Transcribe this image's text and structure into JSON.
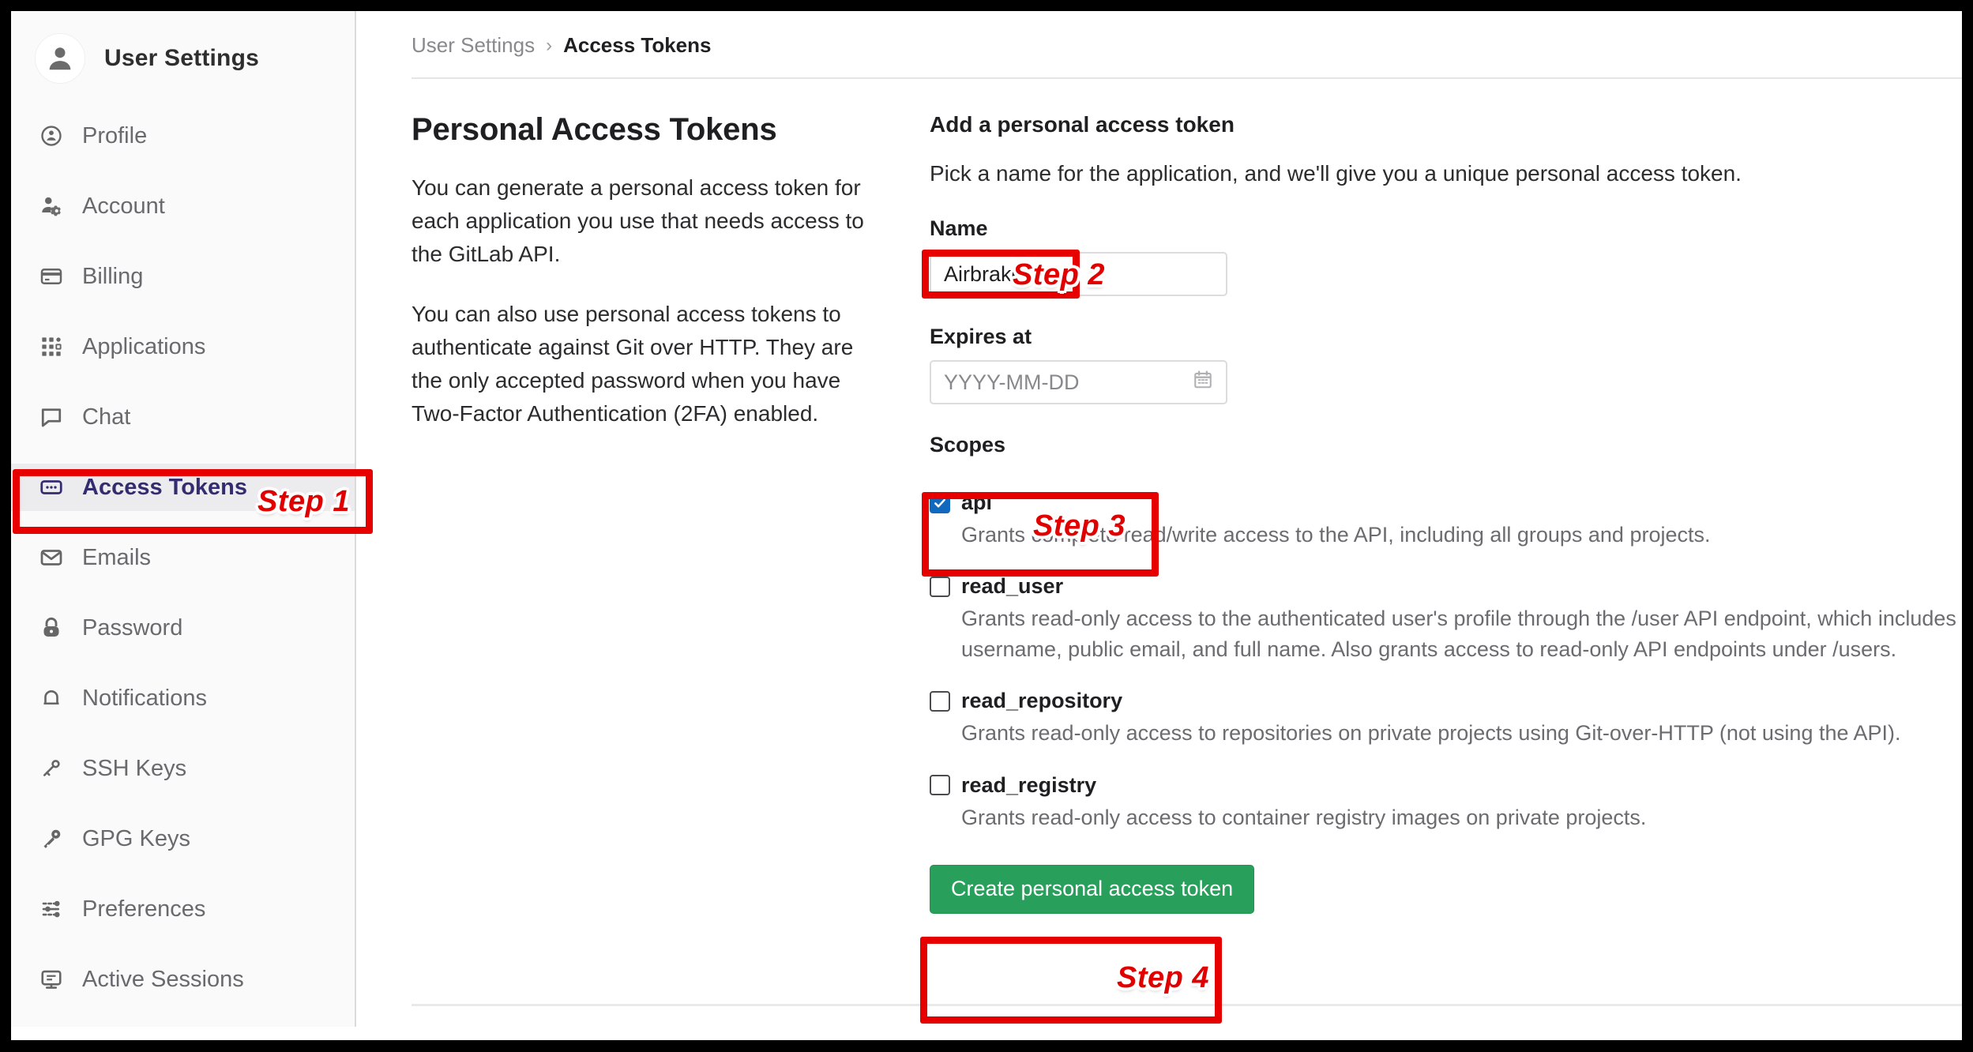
{
  "sidebar": {
    "title": "User Settings",
    "avatar_icon": "user-avatar-icon",
    "items": [
      {
        "label": "Profile",
        "icon": "profile-circle-icon",
        "active": false
      },
      {
        "label": "Account",
        "icon": "account-gear-icon",
        "active": false
      },
      {
        "label": "Billing",
        "icon": "credit-card-icon",
        "active": false
      },
      {
        "label": "Applications",
        "icon": "grid-apps-icon",
        "active": false
      },
      {
        "label": "Chat",
        "icon": "chat-bubble-icon",
        "active": false
      },
      {
        "label": "Access Tokens",
        "icon": "token-icon",
        "active": true
      },
      {
        "label": "Emails",
        "icon": "envelope-icon",
        "active": false
      },
      {
        "label": "Password",
        "icon": "lock-icon",
        "active": false
      },
      {
        "label": "Notifications",
        "icon": "bell-icon",
        "active": false
      },
      {
        "label": "SSH Keys",
        "icon": "key-small-icon",
        "active": false
      },
      {
        "label": "GPG Keys",
        "icon": "key-icon",
        "active": false
      },
      {
        "label": "Preferences",
        "icon": "sliders-icon",
        "active": false
      },
      {
        "label": "Active Sessions",
        "icon": "monitor-icon",
        "active": false
      }
    ]
  },
  "breadcrumb": {
    "parent": "User Settings",
    "separator": "›",
    "current": "Access Tokens"
  },
  "left_column": {
    "heading": "Personal Access Tokens",
    "paragraph_1": "You can generate a personal access token for each application you use that needs access to the GitLab API.",
    "paragraph_2": "You can also use personal access tokens to authenticate against Git over HTTP. They are the only accepted password when you have Two-Factor Authentication (2FA) enabled."
  },
  "form": {
    "title": "Add a personal access token",
    "subtitle": "Pick a name for the application, and we'll give you a unique personal access token.",
    "name_label": "Name",
    "name_value": "Airbrake",
    "expires_label": "Expires at",
    "expires_placeholder": "YYYY-MM-DD",
    "expires_value": "",
    "calendar_icon": "calendar-icon",
    "scopes_label": "Scopes",
    "scopes": [
      {
        "name": "api",
        "checked": true,
        "description": "Grants complete read/write access to the API, including all groups and projects."
      },
      {
        "name": "read_user",
        "checked": false,
        "description": "Grants read-only access to the authenticated user's profile through the /user API endpoint, which includes username, public email, and full name. Also grants access to read-only API endpoints under /users."
      },
      {
        "name": "read_repository",
        "checked": false,
        "description": "Grants read-only access to repositories on private projects using Git-over-HTTP (not using the API)."
      },
      {
        "name": "read_registry",
        "checked": false,
        "description": "Grants read-only access to container registry images on private projects."
      }
    ],
    "submit_label": "Create personal access token"
  },
  "annotations": {
    "step1": "Step 1",
    "step2": "Step 2",
    "step3": "Step 3",
    "step4": "Step 4",
    "highlight_color": "#e60000",
    "label_color": "#e00000"
  },
  "colors": {
    "accent_green": "#28a05c",
    "accent_blue": "#1068bf",
    "active_nav": "#332d70"
  }
}
